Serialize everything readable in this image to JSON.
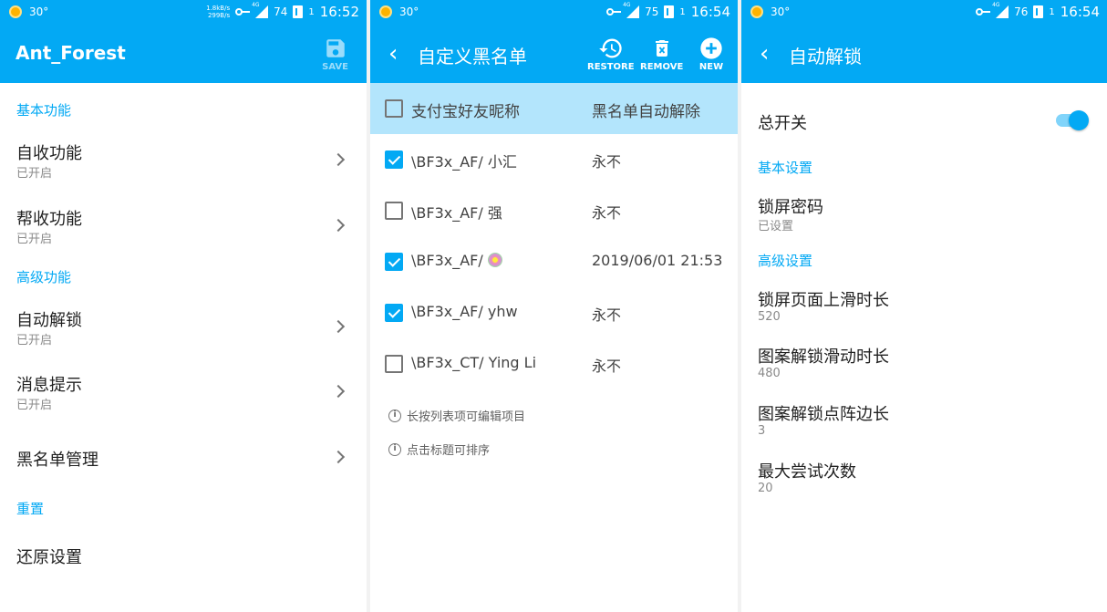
{
  "status_bars": [
    {
      "temp": "30°",
      "net_up": "1.8kB/s",
      "net_down": "299B/s",
      "signal": "4G",
      "battery": "74",
      "sim": "1",
      "time": "16:52"
    },
    {
      "temp": "30°",
      "signal": "4G",
      "battery": "75",
      "sim": "1",
      "time": "16:54"
    },
    {
      "temp": "30°",
      "signal": "4G",
      "battery": "76",
      "sim": "1",
      "time": "16:54"
    }
  ],
  "screen1": {
    "title": "Ant_Forest",
    "save_label": "SAVE",
    "sections": {
      "basic": "基本功能",
      "advanced": "高级功能",
      "reset": "重置"
    },
    "items": [
      {
        "title": "自收功能",
        "subtitle": "已开启"
      },
      {
        "title": "帮收功能",
        "subtitle": "已开启"
      },
      {
        "title": "自动解锁",
        "subtitle": "已开启"
      },
      {
        "title": "消息提示",
        "subtitle": "已开启"
      },
      {
        "title": "黑名单管理",
        "subtitle": ""
      },
      {
        "title": "还原设置",
        "subtitle": ""
      }
    ]
  },
  "screen2": {
    "title": "自定义黑名单",
    "actions": {
      "restore": "RESTORE",
      "remove": "REMOVE",
      "new": "NEW"
    },
    "columns": {
      "name": "支付宝好友昵称",
      "release": "黑名单自动解除"
    },
    "header_checked": false,
    "rows": [
      {
        "name": "\\BF3x_AF/ 小汇",
        "release": "永不",
        "checked": true
      },
      {
        "name": "\\BF3x_AF/ 强",
        "release": "永不",
        "checked": false
      },
      {
        "name": "\\BF3x_AF/ ",
        "release": "2019/06/01 21:53",
        "checked": true
      },
      {
        "name": "\\BF3x_AF/ yhw",
        "release": "永不",
        "checked": true
      },
      {
        "name": "\\BF3x_CT/ Ying Li",
        "release": "永不",
        "checked": false
      }
    ],
    "hints": [
      "长按列表项可编辑项目",
      "点击标题可排序"
    ]
  },
  "screen3": {
    "title": "自动解锁",
    "master_switch": {
      "label": "总开关",
      "on": true
    },
    "sections": {
      "basic": "基本设置",
      "advanced": "高级设置"
    },
    "items": [
      {
        "title": "锁屏密码",
        "subtitle": "已设置"
      },
      {
        "title": "锁屏页面上滑时长",
        "subtitle": "520"
      },
      {
        "title": "图案解锁滑动时长",
        "subtitle": "480"
      },
      {
        "title": "图案解锁点阵边长",
        "subtitle": "3"
      },
      {
        "title": "最大尝试次数",
        "subtitle": "20"
      }
    ]
  },
  "colors": {
    "primary": "#03a9f4",
    "header_highlight": "#b3e5fc",
    "secondary_text": "#8a8a8a"
  }
}
